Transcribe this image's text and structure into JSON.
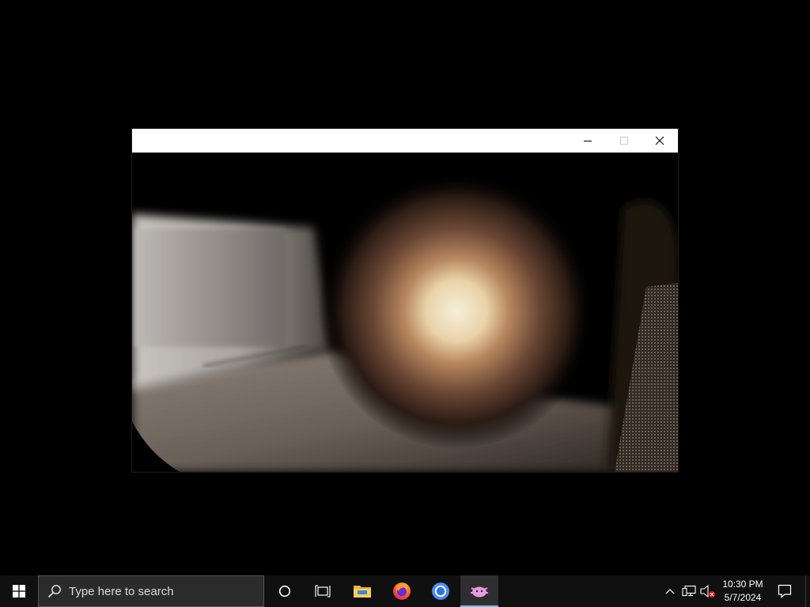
{
  "window": {
    "title": "",
    "controls": {
      "minimize": "minimize-icon",
      "maximize": "maximize-icon",
      "close": "close-icon"
    }
  },
  "taskbar": {
    "search": {
      "placeholder": "Type here to search"
    },
    "pinned": [
      {
        "name": "cortana",
        "icon": "circle-icon"
      },
      {
        "name": "task-view",
        "icon": "task-view-icon"
      },
      {
        "name": "file-explorer",
        "icon": "folder-icon"
      },
      {
        "name": "firefox",
        "icon": "firefox-icon"
      },
      {
        "name": "chrome",
        "icon": "chrome-icon"
      },
      {
        "name": "active-app",
        "icon": "pink-creature-icon",
        "active": true
      }
    ],
    "tray": {
      "icons": [
        "chevron-up-icon",
        "network-icon",
        "volume-muted-icon"
      ],
      "time": "10:30 PM",
      "date": "5/7/2024"
    }
  },
  "colors": {
    "desktop": "#000000",
    "taskbar": "#101010",
    "active_indicator": "#76b9ed",
    "titlebar": "#ffffff"
  }
}
